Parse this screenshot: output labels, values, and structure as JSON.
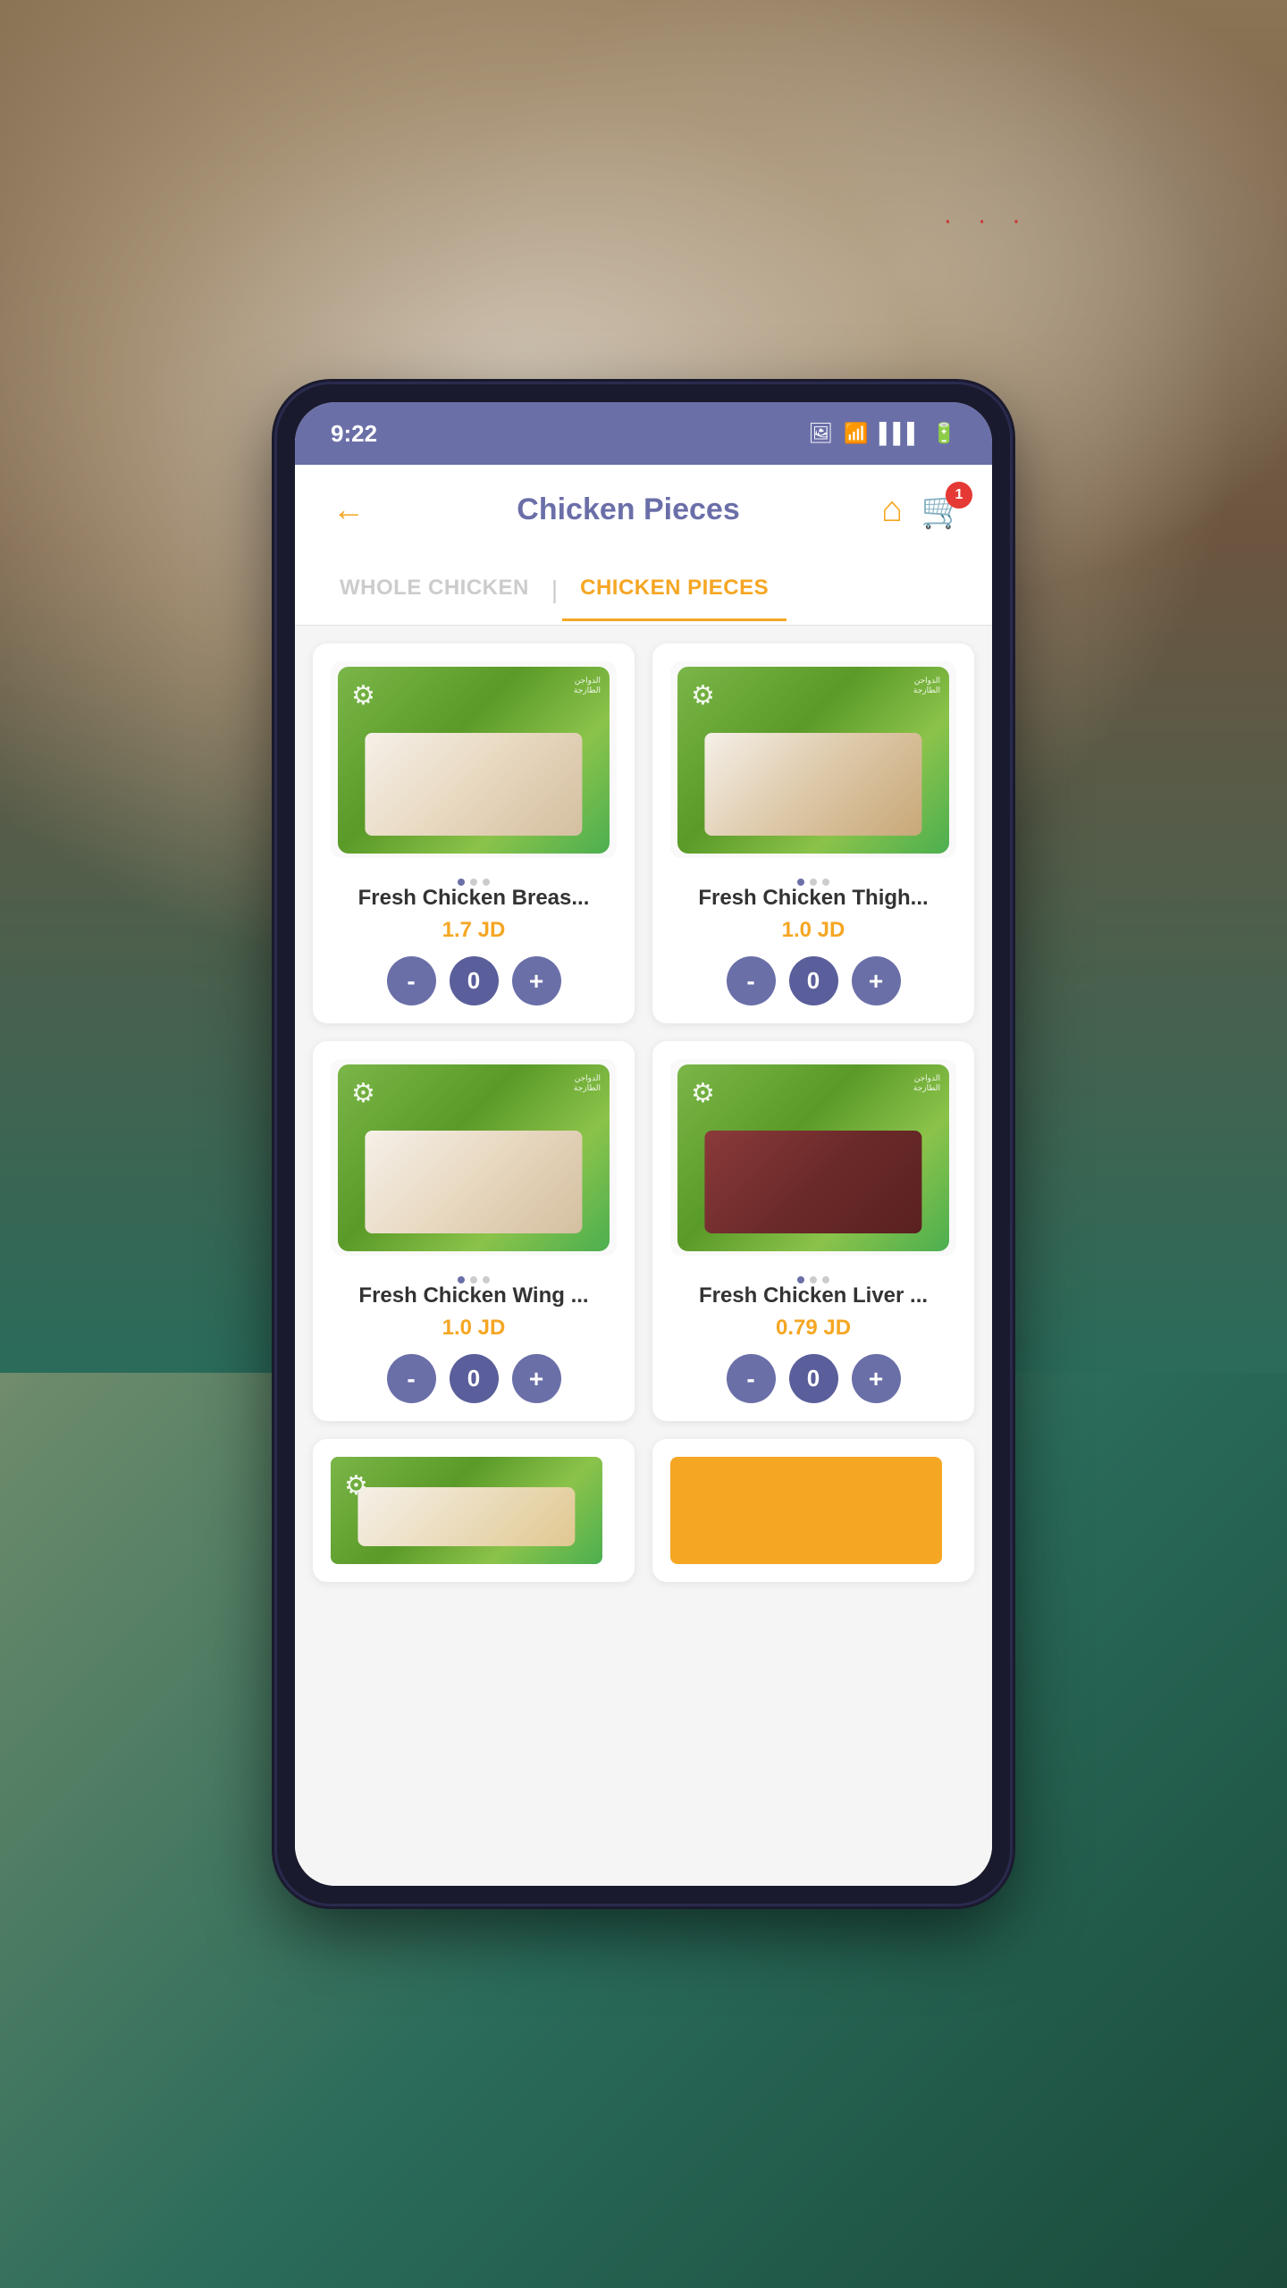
{
  "app": {
    "title": "Chicken Pieces",
    "background_color": "#2a6b5a"
  },
  "status_bar": {
    "time": "9:22",
    "color": "#6b6fa8"
  },
  "header": {
    "back_label": "←",
    "title": "Chicken Pieces",
    "home_icon": "home",
    "cart_icon": "cart",
    "cart_count": "1"
  },
  "tabs": [
    {
      "id": "whole-chicken",
      "label": "WHOLE CHICKEN",
      "active": false
    },
    {
      "id": "chicken-pieces",
      "label": "CHICKEN PIECES",
      "active": true
    }
  ],
  "products": [
    {
      "id": "chicken-breast",
      "name": "Fresh Chicken Breas...",
      "price": "1.7 JD",
      "quantity": 0,
      "tray_type": "breast",
      "dots": [
        true,
        false,
        false
      ]
    },
    {
      "id": "chicken-thigh",
      "name": "Fresh Chicken Thigh...",
      "price": "1.0 JD",
      "quantity": 0,
      "tray_type": "thigh",
      "dots": [
        true,
        false,
        false
      ]
    },
    {
      "id": "chicken-wing",
      "name": "Fresh Chicken Wing ...",
      "price": "1.0 JD",
      "quantity": 0,
      "tray_type": "wing",
      "dots": [
        true,
        false,
        false
      ]
    },
    {
      "id": "chicken-liver",
      "name": "Fresh Chicken Liver ...",
      "price": "0.79 JD",
      "quantity": 0,
      "tray_type": "liver",
      "dots": [
        true,
        false,
        false
      ]
    }
  ],
  "partial_products": [
    {
      "id": "partial-1",
      "tray_type": "wing"
    },
    {
      "id": "partial-2",
      "tray_type": "thigh"
    }
  ],
  "controls": {
    "minus_label": "-",
    "plus_label": "+"
  }
}
